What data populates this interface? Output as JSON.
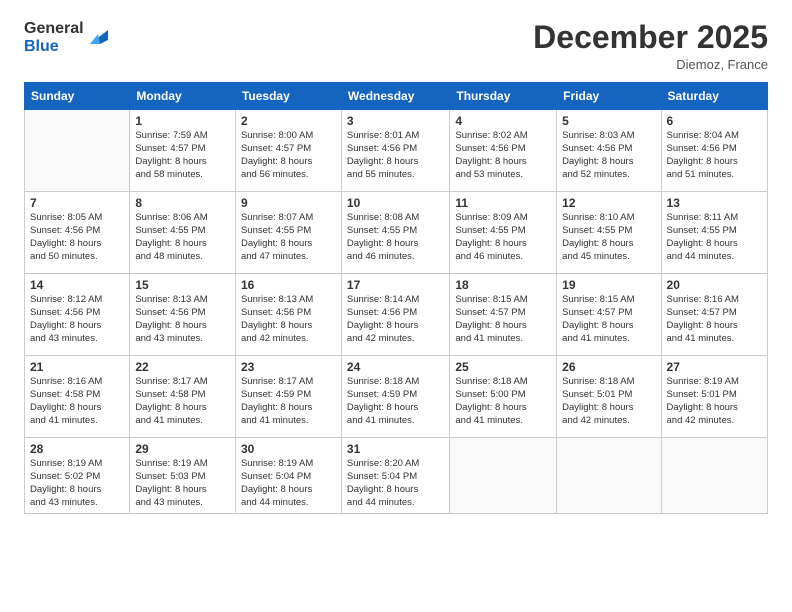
{
  "header": {
    "logo_general": "General",
    "logo_blue": "Blue",
    "month_title": "December 2025",
    "location": "Diemoz, France"
  },
  "days_of_week": [
    "Sunday",
    "Monday",
    "Tuesday",
    "Wednesday",
    "Thursday",
    "Friday",
    "Saturday"
  ],
  "weeks": [
    [
      {
        "day": "",
        "info": ""
      },
      {
        "day": "1",
        "info": "Sunrise: 7:59 AM\nSunset: 4:57 PM\nDaylight: 8 hours\nand 58 minutes."
      },
      {
        "day": "2",
        "info": "Sunrise: 8:00 AM\nSunset: 4:57 PM\nDaylight: 8 hours\nand 56 minutes."
      },
      {
        "day": "3",
        "info": "Sunrise: 8:01 AM\nSunset: 4:56 PM\nDaylight: 8 hours\nand 55 minutes."
      },
      {
        "day": "4",
        "info": "Sunrise: 8:02 AM\nSunset: 4:56 PM\nDaylight: 8 hours\nand 53 minutes."
      },
      {
        "day": "5",
        "info": "Sunrise: 8:03 AM\nSunset: 4:56 PM\nDaylight: 8 hours\nand 52 minutes."
      },
      {
        "day": "6",
        "info": "Sunrise: 8:04 AM\nSunset: 4:56 PM\nDaylight: 8 hours\nand 51 minutes."
      }
    ],
    [
      {
        "day": "7",
        "info": "Sunrise: 8:05 AM\nSunset: 4:56 PM\nDaylight: 8 hours\nand 50 minutes."
      },
      {
        "day": "8",
        "info": "Sunrise: 8:06 AM\nSunset: 4:55 PM\nDaylight: 8 hours\nand 48 minutes."
      },
      {
        "day": "9",
        "info": "Sunrise: 8:07 AM\nSunset: 4:55 PM\nDaylight: 8 hours\nand 47 minutes."
      },
      {
        "day": "10",
        "info": "Sunrise: 8:08 AM\nSunset: 4:55 PM\nDaylight: 8 hours\nand 46 minutes."
      },
      {
        "day": "11",
        "info": "Sunrise: 8:09 AM\nSunset: 4:55 PM\nDaylight: 8 hours\nand 46 minutes."
      },
      {
        "day": "12",
        "info": "Sunrise: 8:10 AM\nSunset: 4:55 PM\nDaylight: 8 hours\nand 45 minutes."
      },
      {
        "day": "13",
        "info": "Sunrise: 8:11 AM\nSunset: 4:55 PM\nDaylight: 8 hours\nand 44 minutes."
      }
    ],
    [
      {
        "day": "14",
        "info": "Sunrise: 8:12 AM\nSunset: 4:56 PM\nDaylight: 8 hours\nand 43 minutes."
      },
      {
        "day": "15",
        "info": "Sunrise: 8:13 AM\nSunset: 4:56 PM\nDaylight: 8 hours\nand 43 minutes."
      },
      {
        "day": "16",
        "info": "Sunrise: 8:13 AM\nSunset: 4:56 PM\nDaylight: 8 hours\nand 42 minutes."
      },
      {
        "day": "17",
        "info": "Sunrise: 8:14 AM\nSunset: 4:56 PM\nDaylight: 8 hours\nand 42 minutes."
      },
      {
        "day": "18",
        "info": "Sunrise: 8:15 AM\nSunset: 4:57 PM\nDaylight: 8 hours\nand 41 minutes."
      },
      {
        "day": "19",
        "info": "Sunrise: 8:15 AM\nSunset: 4:57 PM\nDaylight: 8 hours\nand 41 minutes."
      },
      {
        "day": "20",
        "info": "Sunrise: 8:16 AM\nSunset: 4:57 PM\nDaylight: 8 hours\nand 41 minutes."
      }
    ],
    [
      {
        "day": "21",
        "info": "Sunrise: 8:16 AM\nSunset: 4:58 PM\nDaylight: 8 hours\nand 41 minutes."
      },
      {
        "day": "22",
        "info": "Sunrise: 8:17 AM\nSunset: 4:58 PM\nDaylight: 8 hours\nand 41 minutes."
      },
      {
        "day": "23",
        "info": "Sunrise: 8:17 AM\nSunset: 4:59 PM\nDaylight: 8 hours\nand 41 minutes."
      },
      {
        "day": "24",
        "info": "Sunrise: 8:18 AM\nSunset: 4:59 PM\nDaylight: 8 hours\nand 41 minutes."
      },
      {
        "day": "25",
        "info": "Sunrise: 8:18 AM\nSunset: 5:00 PM\nDaylight: 8 hours\nand 41 minutes."
      },
      {
        "day": "26",
        "info": "Sunrise: 8:18 AM\nSunset: 5:01 PM\nDaylight: 8 hours\nand 42 minutes."
      },
      {
        "day": "27",
        "info": "Sunrise: 8:19 AM\nSunset: 5:01 PM\nDaylight: 8 hours\nand 42 minutes."
      }
    ],
    [
      {
        "day": "28",
        "info": "Sunrise: 8:19 AM\nSunset: 5:02 PM\nDaylight: 8 hours\nand 43 minutes."
      },
      {
        "day": "29",
        "info": "Sunrise: 8:19 AM\nSunset: 5:03 PM\nDaylight: 8 hours\nand 43 minutes."
      },
      {
        "day": "30",
        "info": "Sunrise: 8:19 AM\nSunset: 5:04 PM\nDaylight: 8 hours\nand 44 minutes."
      },
      {
        "day": "31",
        "info": "Sunrise: 8:20 AM\nSunset: 5:04 PM\nDaylight: 8 hours\nand 44 minutes."
      },
      {
        "day": "",
        "info": ""
      },
      {
        "day": "",
        "info": ""
      },
      {
        "day": "",
        "info": ""
      }
    ]
  ]
}
